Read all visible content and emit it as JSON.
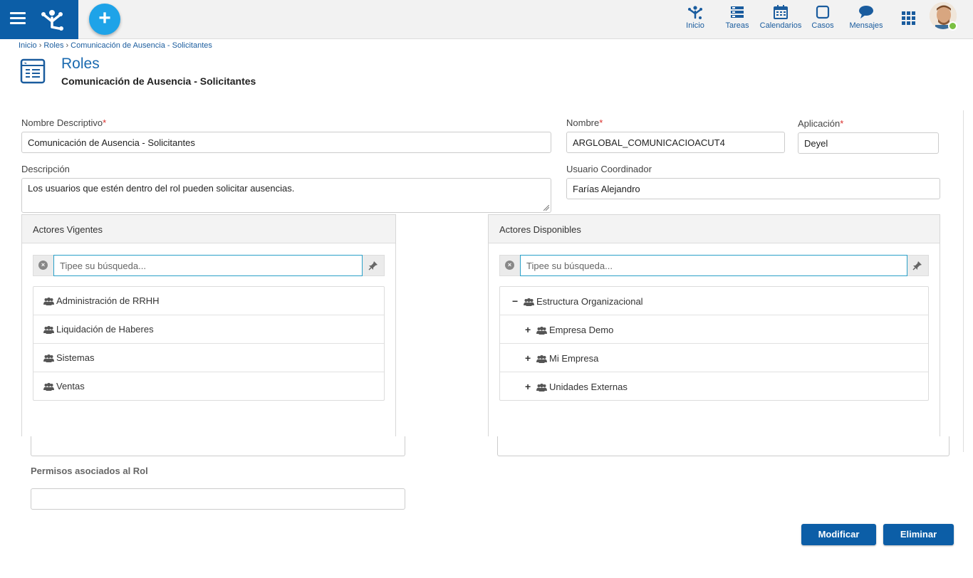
{
  "topbar": {
    "nav": [
      {
        "id": "inicio",
        "label": "Inicio",
        "icon": "network-icon"
      },
      {
        "id": "tareas",
        "label": "Tareas",
        "icon": "tasks-icon"
      },
      {
        "id": "calendarios",
        "label": "Calendarios",
        "icon": "calendar-icon"
      },
      {
        "id": "casos",
        "label": "Casos",
        "icon": "cases-icon"
      },
      {
        "id": "mensajes",
        "label": "Mensajes",
        "icon": "chat-icon"
      }
    ],
    "add_label": "+",
    "colors": {
      "brand": "#0c5ea7",
      "accent": "#1ea3e8",
      "online": "#7bc043"
    }
  },
  "breadcrumb": [
    "Inicio",
    "Roles",
    "Comunicación de Ausencia - Solicitantes"
  ],
  "page": {
    "title": "Roles",
    "subtitle": "Comunicación de Ausencia - Solicitantes"
  },
  "form": {
    "nombre_descriptivo": {
      "label": "Nombre Descriptivo",
      "value": "Comunicación de Ausencia - Solicitantes"
    },
    "nombre": {
      "label": "Nombre",
      "value": "ARGLOBAL_COMUNICACIOACUT4"
    },
    "aplicacion": {
      "label": "Aplicación",
      "value": "Deyel"
    },
    "descripcion": {
      "label": "Descripción",
      "value": "Los usuarios que estén dentro del rol pueden solicitar ausencias."
    },
    "usuario_coordinador": {
      "label": "Usuario Coordinador",
      "value": "Farías Alejandro"
    },
    "required_mark": "*"
  },
  "actores_vigentes": {
    "title": "Actores Vigentes",
    "search_placeholder": "Tipee su búsqueda...",
    "items": [
      "Administración de RRHH",
      "Liquidación de Haberes",
      "Sistemas",
      "Ventas"
    ]
  },
  "actores_disponibles": {
    "title": "Actores Disponibles",
    "search_placeholder": "Tipee su búsqueda...",
    "root": {
      "label": "Estructura Organizacional",
      "toggle": "−"
    },
    "children": [
      {
        "label": "Empresa Demo",
        "toggle": "+"
      },
      {
        "label": "Mi Empresa",
        "toggle": "+"
      },
      {
        "label": "Unidades Externas",
        "toggle": "+"
      }
    ]
  },
  "permisos": {
    "title": "Permisos asociados al Rol"
  },
  "actions": {
    "modificar": "Modificar",
    "eliminar": "Eliminar"
  }
}
